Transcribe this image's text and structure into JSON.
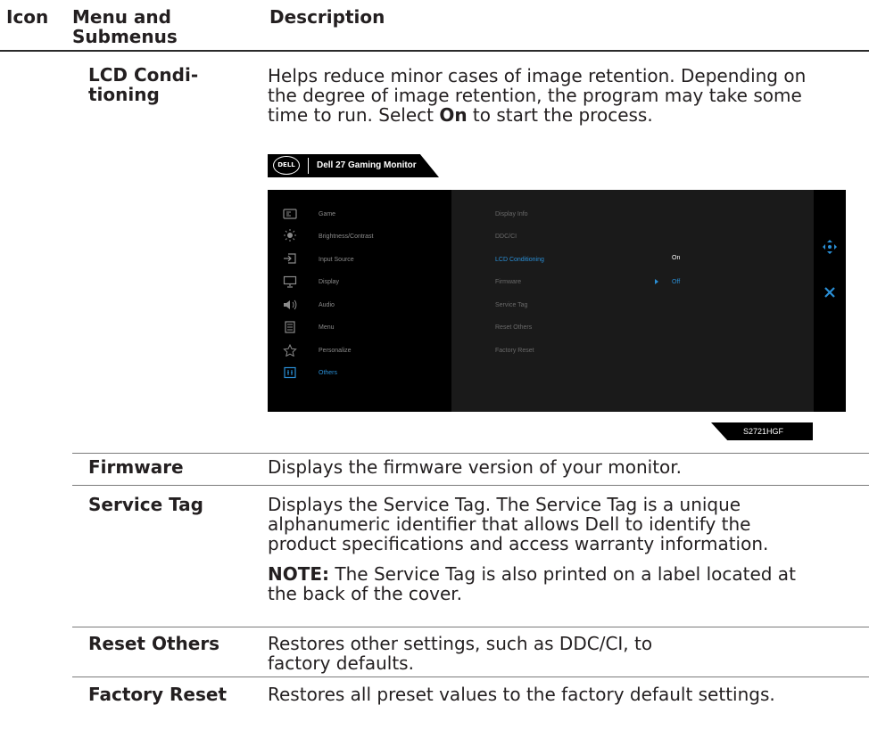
{
  "table": {
    "headers": {
      "icon": "Icon",
      "menu": "Menu and",
      "menu2": "Submenus",
      "description": "Description"
    },
    "rows": [
      {
        "submenu1": "LCD Condi-",
        "submenu2": "tioning",
        "desc1": "Helps reduce minor cases of image retention. Depending on",
        "desc2": "the degree of image retention, the program may take some",
        "desc3_pre": "time to run. Select ",
        "desc3_bold": "On",
        "desc3_post": " to start the process."
      },
      {
        "submenu": "Firmware",
        "desc1": "Displays the firmware version of your monitor."
      },
      {
        "submenu": "Service Tag",
        "desc1": "Displays the Service Tag. The Service Tag is a unique",
        "desc2": "alphanumeric identifier that allows Dell to identify the",
        "desc3": "product specifications and access warranty information.",
        "note_label": "NOTE:",
        "note1": " The Service Tag is also printed on a label located at",
        "note2": "the back of the cover."
      },
      {
        "submenu": "Reset Others",
        "desc1": "Restores other settings, such as DDC/CI, to",
        "desc2": "factory defaults."
      },
      {
        "submenu": "Factory Reset",
        "desc1": "Restores all preset values to the factory default settings."
      }
    ]
  },
  "osd": {
    "logo": "DELL",
    "title": "Dell 27 Gaming Monitor",
    "menu_items": [
      {
        "label": "Game",
        "icon": "game-icon"
      },
      {
        "label": "Brightness/Contrast",
        "icon": "brightness-icon"
      },
      {
        "label": "Input Source",
        "icon": "input-source-icon"
      },
      {
        "label": "Display",
        "icon": "display-icon"
      },
      {
        "label": "Audio",
        "icon": "audio-icon"
      },
      {
        "label": "Menu",
        "icon": "menu-icon"
      },
      {
        "label": "Personalize",
        "icon": "star-icon"
      },
      {
        "label": "Others",
        "icon": "others-icon"
      }
    ],
    "active_menu": "Others",
    "sub_items": [
      "Display Info",
      "DDC/CI",
      "LCD Conditioning",
      "Firmware",
      "Service Tag",
      "Reset Others",
      "Factory Reset"
    ],
    "active_sub": "LCD Conditioning",
    "options": {
      "on": "On",
      "off": "Off"
    },
    "model": "S2721HGF",
    "accent_color": "#2a8fd6"
  }
}
